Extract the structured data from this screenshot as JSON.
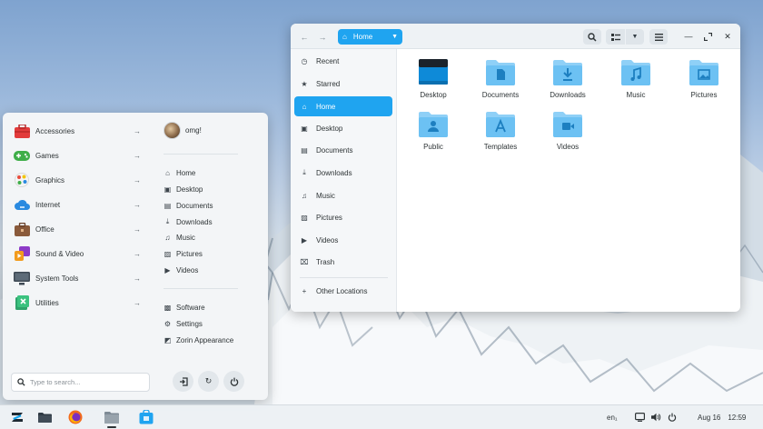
{
  "file_manager": {
    "path_label": "Home",
    "sidebar": [
      {
        "label": "Recent",
        "icon": "clock-icon",
        "glyph": "◷",
        "active": false
      },
      {
        "label": "Starred",
        "icon": "star-icon",
        "glyph": "★",
        "active": false
      },
      {
        "label": "Home",
        "icon": "home-icon",
        "glyph": "⌂",
        "active": true
      },
      {
        "label": "Desktop",
        "icon": "desktop-icon",
        "glyph": "▣",
        "active": false
      },
      {
        "label": "Documents",
        "icon": "document-icon",
        "glyph": "▤",
        "active": false
      },
      {
        "label": "Downloads",
        "icon": "download-icon",
        "glyph": "⤓",
        "active": false
      },
      {
        "label": "Music",
        "icon": "music-icon",
        "glyph": "♫",
        "active": false
      },
      {
        "label": "Pictures",
        "icon": "picture-icon",
        "glyph": "▨",
        "active": false
      },
      {
        "label": "Videos",
        "icon": "video-icon",
        "glyph": "▶",
        "active": false
      },
      {
        "label": "Trash",
        "icon": "trash-icon",
        "glyph": "⌧",
        "active": false
      }
    ],
    "other_locations": "Other Locations",
    "files": [
      {
        "label": "Desktop",
        "kind": "desktop"
      },
      {
        "label": "Documents",
        "kind": "documents"
      },
      {
        "label": "Downloads",
        "kind": "downloads"
      },
      {
        "label": "Music",
        "kind": "music"
      },
      {
        "label": "Pictures",
        "kind": "pictures"
      },
      {
        "label": "Public",
        "kind": "public"
      },
      {
        "label": "Templates",
        "kind": "templates"
      },
      {
        "label": "Videos",
        "kind": "videos"
      }
    ]
  },
  "start_menu": {
    "categories": [
      {
        "label": "Accessories",
        "icon": "accessories-icon",
        "color": "#e23b3b"
      },
      {
        "label": "Games",
        "icon": "games-icon",
        "color": "#3fae49"
      },
      {
        "label": "Graphics",
        "icon": "graphics-icon",
        "color": "#f1a01c"
      },
      {
        "label": "Internet",
        "icon": "internet-icon",
        "color": "#2a8ae0"
      },
      {
        "label": "Office",
        "icon": "office-icon",
        "color": "#8a5a3b"
      },
      {
        "label": "Sound & Video",
        "icon": "sound-video-icon",
        "color": "#8d3bc7"
      },
      {
        "label": "System Tools",
        "icon": "system-tools-icon",
        "color": "#3f4a55"
      },
      {
        "label": "Utilities",
        "icon": "utilities-icon",
        "color": "#2fa36b"
      }
    ],
    "user_name": "omg!",
    "places": [
      {
        "label": "Home",
        "icon": "home-icon",
        "glyph": "⌂"
      },
      {
        "label": "Desktop",
        "icon": "desktop-icon",
        "glyph": "▣"
      },
      {
        "label": "Documents",
        "icon": "document-icon",
        "glyph": "▤"
      },
      {
        "label": "Downloads",
        "icon": "download-icon",
        "glyph": "⤓"
      },
      {
        "label": "Music",
        "icon": "music-icon",
        "glyph": "♫"
      },
      {
        "label": "Pictures",
        "icon": "picture-icon",
        "glyph": "▨"
      },
      {
        "label": "Videos",
        "icon": "video-icon",
        "glyph": "▶"
      }
    ],
    "system": [
      {
        "label": "Software",
        "icon": "software-icon",
        "glyph": "▩"
      },
      {
        "label": "Settings",
        "icon": "gear-icon",
        "glyph": "⚙"
      },
      {
        "label": "Zorin Appearance",
        "icon": "appearance-icon",
        "glyph": "◩"
      }
    ],
    "search_placeholder": "Type to search..."
  },
  "taskbar": {
    "keyboard_layout": "en₁",
    "date": "Aug 16",
    "time": "12:59"
  },
  "colors": {
    "accent": "#1fa4f0",
    "folder_light": "#8fd0f7",
    "folder_dark": "#5bb9f0"
  }
}
